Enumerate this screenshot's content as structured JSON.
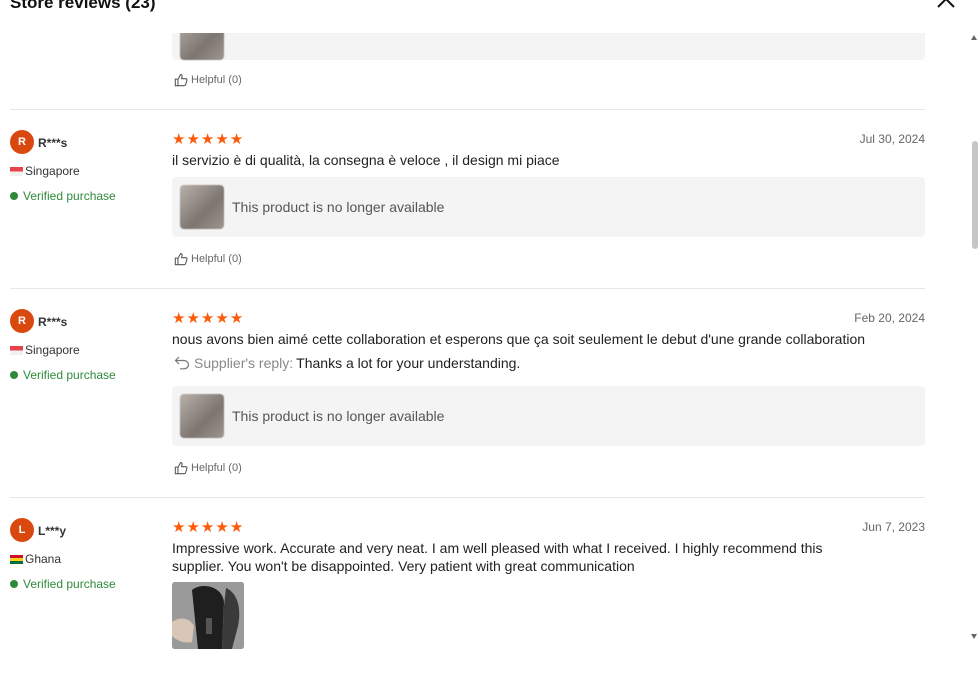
{
  "header": {
    "title": "Store reviews (23)"
  },
  "icons": {
    "close": "close-icon",
    "helpful": "thumbs-up-icon",
    "reply": "reply-arrow-icon",
    "verified": "verified-check-icon"
  },
  "colors": {
    "star": "#fd5b0b",
    "verified": "#2e8b3a",
    "avatar": "#d9480f"
  },
  "top_partial": {
    "helpful": "Helpful (0)"
  },
  "reviews": [
    {
      "avatar_letter": "R",
      "name": "R***s",
      "country": "Singapore",
      "verified": "Verified purchase",
      "rating": 5,
      "date": "Jul 30, 2024",
      "text": "il servizio è di qualità, la consegna è veloce , il design mi piace",
      "product": "This product is no longer available",
      "helpful": "Helpful (0)"
    },
    {
      "avatar_letter": "R",
      "name": "R***s",
      "country": "Singapore",
      "verified": "Verified purchase",
      "rating": 5,
      "date": "Feb 20, 2024",
      "text": "nous avons bien aimé cette collaboration et esperons que ça soit seulement le debut d'une grande collaboration",
      "reply_label": "Supplier's reply:",
      "reply_text": "Thanks a lot for your understanding.",
      "product": "This product is no longer available",
      "helpful": "Helpful (0)"
    },
    {
      "avatar_letter": "L",
      "name": "L***y",
      "country": "Ghana",
      "verified": "Verified purchase",
      "rating": 5,
      "date": "Jun 7, 2023",
      "text": "Impressive work. Accurate and very neat. I am well pleased with what I received. I highly recommend this supplier. You won't be disappointed. Very patient with great communication"
    }
  ]
}
